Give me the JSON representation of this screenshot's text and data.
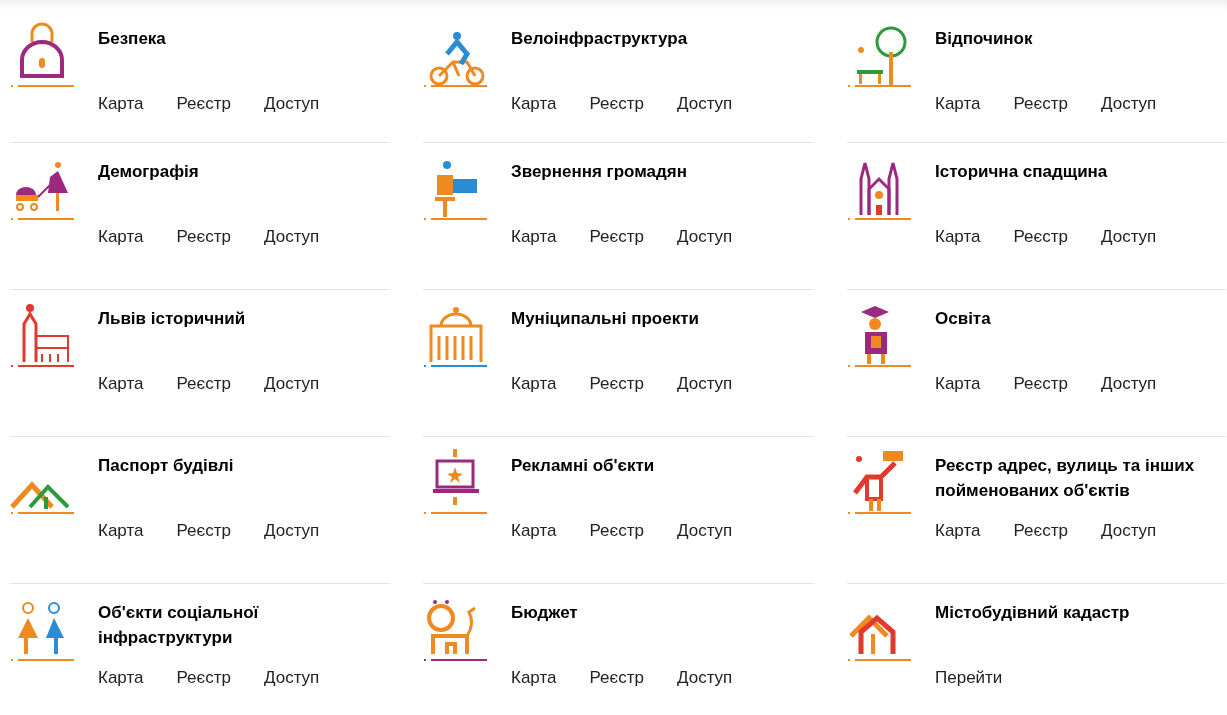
{
  "cards": [
    {
      "title": "Безпека",
      "links": [
        "Карта",
        "Реєстр",
        "Доступ"
      ]
    },
    {
      "title": "Велоінфраструктура",
      "links": [
        "Карта",
        "Реєстр",
        "Доступ"
      ]
    },
    {
      "title": "Відпочинок",
      "links": [
        "Карта",
        "Реєстр",
        "Доступ"
      ]
    },
    {
      "title": "Демографія",
      "links": [
        "Карта",
        "Реєстр",
        "Доступ"
      ]
    },
    {
      "title": "Звернення громадян",
      "links": [
        "Карта",
        "Реєстр",
        "Доступ"
      ]
    },
    {
      "title": "Історична спадщина",
      "links": [
        "Карта",
        "Реєстр",
        "Доступ"
      ]
    },
    {
      "title": "Львів історичний",
      "links": [
        "Карта",
        "Реєстр",
        "Доступ"
      ]
    },
    {
      "title": "Муніципальні проекти",
      "links": [
        "Карта",
        "Реєстр",
        "Доступ"
      ]
    },
    {
      "title": "Освіта",
      "links": [
        "Карта",
        "Реєстр",
        "Доступ"
      ]
    },
    {
      "title": "Паспорт будівлі",
      "links": [
        "Карта",
        "Реєстр",
        "Доступ"
      ]
    },
    {
      "title": "Рекламні об'єкти",
      "links": [
        "Карта",
        "Реєстр",
        "Доступ"
      ]
    },
    {
      "title": "Реєстр адрес, вулиць та інших пойменованих об'єктів",
      "links": [
        "Карта",
        "Реєстр",
        "Доступ"
      ]
    },
    {
      "title": "Об'єкти соціальної інфраструктури",
      "links": [
        "Карта",
        "Реєстр",
        "Доступ"
      ]
    },
    {
      "title": "Бюджет",
      "links": [
        "Карта",
        "Реєстр",
        "Доступ"
      ]
    },
    {
      "title": "Містобудівний кадастр",
      "links": [
        "Перейти"
      ]
    }
  ]
}
